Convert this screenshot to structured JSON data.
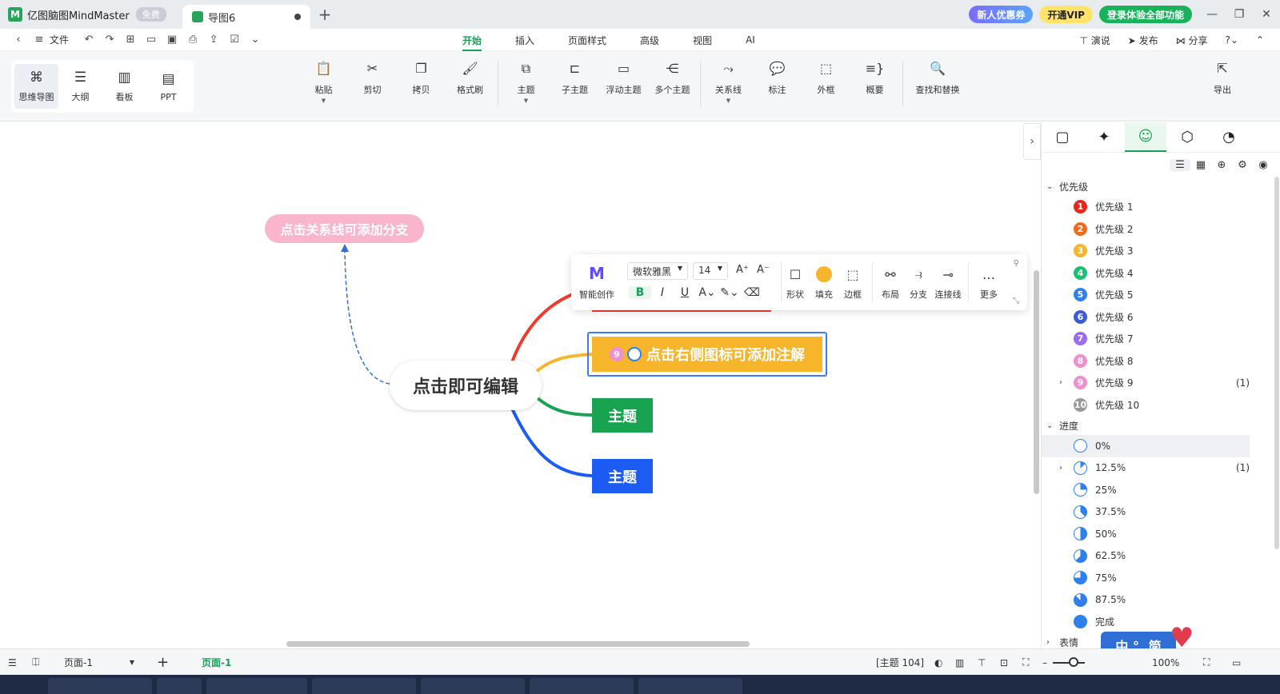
{
  "titlebar": {
    "app_name": "亿图脑图MindMaster",
    "free_badge": "免费",
    "doc_tab": "导图6",
    "coupon": "新人优惠券",
    "vip": "开通VIP",
    "login": "登录体验全部功能"
  },
  "menubar": {
    "file": "文件",
    "tabs": [
      "开始",
      "插入",
      "页面样式",
      "高级",
      "视图",
      "AI"
    ],
    "right": [
      "演说",
      "发布",
      "分享"
    ]
  },
  "ribbon": {
    "views": [
      "思维导图",
      "大纲",
      "看板",
      "PPT"
    ],
    "tools": [
      "粘贴",
      "剪切",
      "拷贝",
      "格式刷",
      "主题",
      "子主题",
      "浮动主题",
      "多个主题",
      "关系线",
      "标注",
      "外框",
      "概要",
      "查找和替换"
    ],
    "export": "导出"
  },
  "canvas": {
    "floating_topic": "点击关系线可添加分支",
    "central_topic": "点击即可编辑",
    "topic_yellow": "点击右侧图标可添加注解",
    "topic_yellow_badge": "9",
    "topic_green": "主题",
    "topic_blue": "主题",
    "branch_colors": [
      "#f03a2e",
      "#f7b52c",
      "#18a350",
      "#1c5cf5"
    ]
  },
  "format_toolbar": {
    "ai_label": "智能创作",
    "font": "微软雅黑",
    "size": "14",
    "grow": "A⁺",
    "shrink": "A⁻",
    "shape": "形状",
    "fill": "填充",
    "border": "边框",
    "layout": "布局",
    "branch": "分支",
    "connector": "连接线",
    "more": "更多"
  },
  "right_panel": {
    "priority_group": "优先级",
    "priorities": [
      {
        "n": "1",
        "label": "优先级 1",
        "color": "#e8261c"
      },
      {
        "n": "2",
        "label": "优先级 2",
        "color": "#f26b1d"
      },
      {
        "n": "3",
        "label": "优先级 3",
        "color": "#f7b52c"
      },
      {
        "n": "4",
        "label": "优先级 4",
        "color": "#1dbf73"
      },
      {
        "n": "5",
        "label": "优先级 5",
        "color": "#2f80ed"
      },
      {
        "n": "6",
        "label": "优先级 6",
        "color": "#3d5bd6"
      },
      {
        "n": "7",
        "label": "优先级 7",
        "color": "#9a6cf0"
      },
      {
        "n": "8",
        "label": "优先级 8",
        "color": "#f08fd0"
      },
      {
        "n": "9",
        "label": "优先级 9",
        "color": "#f08fd0",
        "count": "(1)"
      },
      {
        "n": "10",
        "label": "优先级 10",
        "color": "#9a9a9a"
      }
    ],
    "progress_group": "进度",
    "progress": [
      {
        "label": "0%",
        "fraction": 0
      },
      {
        "label": "12.5%",
        "fraction": 0.125,
        "count": "(1)"
      },
      {
        "label": "25%",
        "fraction": 0.25
      },
      {
        "label": "37.5%",
        "fraction": 0.375
      },
      {
        "label": "50%",
        "fraction": 0.5
      },
      {
        "label": "62.5%",
        "fraction": 0.625
      },
      {
        "label": "75%",
        "fraction": 0.75
      },
      {
        "label": "87.5%",
        "fraction": 0.875
      },
      {
        "label": "完成",
        "fraction": 1
      }
    ],
    "emotion_group": "表情"
  },
  "statusbar": {
    "page_select": "页面-1",
    "page_tab": "页面-1",
    "topic_count": "[主题 104]",
    "zoom": "100%"
  },
  "ime": "中 °, 简"
}
